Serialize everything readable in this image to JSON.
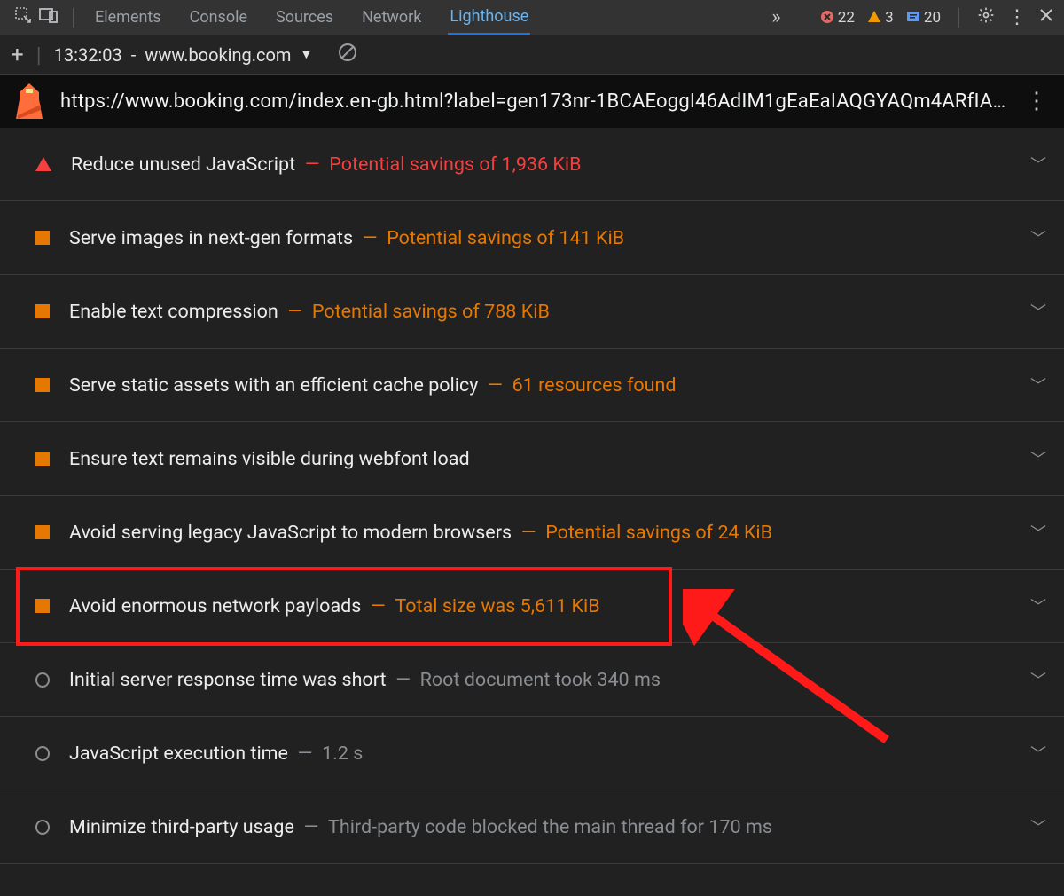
{
  "tabs": {
    "items": [
      "Elements",
      "Console",
      "Sources",
      "Network",
      "Lighthouse"
    ],
    "active_index": 4,
    "overflow_glyph": "»"
  },
  "status": {
    "errors": "22",
    "warnings": "3",
    "infos": "20"
  },
  "subbar": {
    "timestamp": "13:32:03",
    "site": "www.booking.com"
  },
  "url": "https://www.booking.com/index.en-gb.html?label=gen173nr-1BCAEoggI46AdIM1gEaEaIAQGYAQm4ARfIA…",
  "audits": [
    {
      "shape": "tri",
      "title": "Reduce unused JavaScript",
      "detail": "Potential savings of 1,936 KiB",
      "detail_style": "red"
    },
    {
      "shape": "sq",
      "title": "Serve images in next-gen formats",
      "detail": "Potential savings of 141 KiB",
      "detail_style": "orange"
    },
    {
      "shape": "sq",
      "title": "Enable text compression",
      "detail": "Potential savings of 788 KiB",
      "detail_style": "orange"
    },
    {
      "shape": "sq",
      "title": "Serve static assets with an efficient cache policy",
      "detail": "61 resources found",
      "detail_style": "orange"
    },
    {
      "shape": "sq",
      "title": "Ensure text remains visible during webfont load",
      "detail": "",
      "detail_style": ""
    },
    {
      "shape": "sq",
      "title": "Avoid serving legacy JavaScript to modern browsers",
      "detail": "Potential savings of 24 KiB",
      "detail_style": "orange"
    },
    {
      "shape": "sq",
      "title": "Avoid enormous network payloads",
      "detail": "Total size was 5,611 KiB",
      "detail_style": "orange",
      "highlighted": true
    },
    {
      "shape": "circ",
      "title": "Initial server response time was short",
      "detail": "Root document took 340 ms",
      "detail_style": "gray"
    },
    {
      "shape": "circ",
      "title": "JavaScript execution time",
      "detail": "1.2 s",
      "detail_style": "gray"
    },
    {
      "shape": "circ",
      "title": "Minimize third-party usage",
      "detail": "Third-party code blocked the main thread for 170 ms",
      "detail_style": "gray"
    }
  ]
}
